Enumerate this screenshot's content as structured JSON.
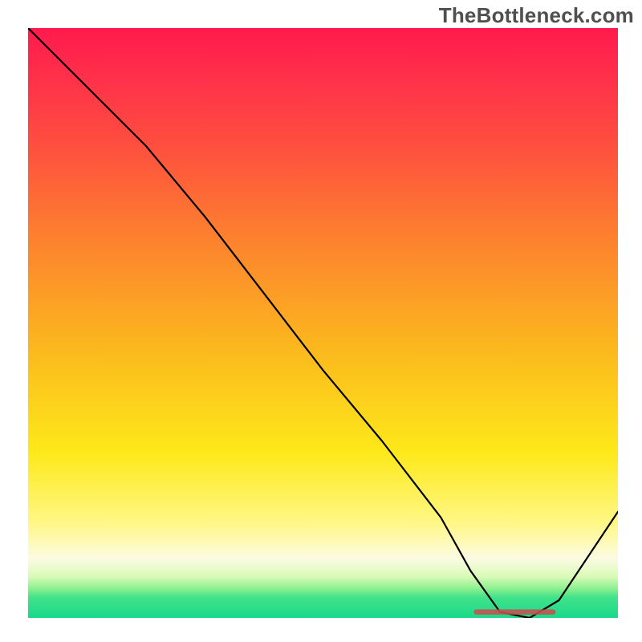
{
  "watermark": "TheBottleneck.com",
  "chart_data": {
    "type": "line",
    "title": "",
    "xlabel": "",
    "ylabel": "",
    "xlim": [
      0,
      100
    ],
    "ylim": [
      0,
      100
    ],
    "grid": false,
    "legend": false,
    "series": [
      {
        "name": "bottleneck-curve",
        "x": [
          0,
          10,
          20,
          30,
          40,
          50,
          60,
          70,
          75,
          80,
          85,
          90,
          100
        ],
        "y": [
          100,
          90,
          80,
          68,
          55,
          42,
          30,
          17,
          8,
          1,
          0,
          3,
          18
        ]
      }
    ],
    "annotations": [
      {
        "name": "optimal-marker",
        "x_start": 76,
        "x_end": 89,
        "y": 1
      }
    ],
    "gradient_stops": [
      {
        "pos": 0.0,
        "color": "#ff1a4d"
      },
      {
        "pos": 0.2,
        "color": "#fe4f3f"
      },
      {
        "pos": 0.55,
        "color": "#fbba1d"
      },
      {
        "pos": 0.84,
        "color": "#fff787"
      },
      {
        "pos": 0.93,
        "color": "#d9fbb7"
      },
      {
        "pos": 1.0,
        "color": "#19d98a"
      }
    ]
  }
}
